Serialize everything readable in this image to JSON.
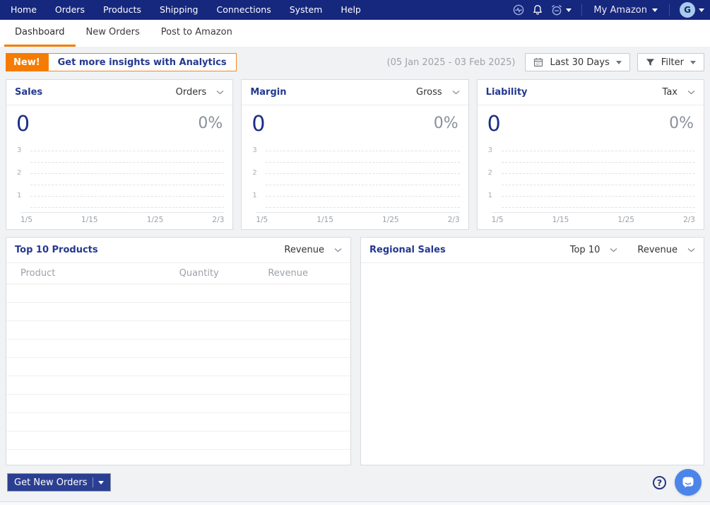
{
  "colors": {
    "navbar": "#16277E",
    "accent_orange": "#F57C00",
    "title_navy": "#24388F",
    "value_navy": "#1B2F87",
    "muted_gray": "#8A909A",
    "button_navy": "#2B3F92",
    "chat_blue": "#4C85EA",
    "avatar_blue": "#A9CBEE"
  },
  "navbar": {
    "items": [
      "Home",
      "Orders",
      "Products",
      "Shipping",
      "Connections",
      "System",
      "Help"
    ],
    "icons": [
      "activity-icon",
      "notifications-bell-icon",
      "snooze-alarm-icon"
    ],
    "account_label": "My Amazon",
    "avatar_initial": "G"
  },
  "tabs": {
    "dashboard": "Dashboard",
    "new_orders": "New Orders",
    "post_to_amazon": "Post to Amazon",
    "active": "Dashboard"
  },
  "toolbar": {
    "new_badge": "New!",
    "analytics_label": "Get more insights with Analytics",
    "date_range": "(05 Jan 2025 - 03 Feb 2025)",
    "period_label": "Last 30 Days",
    "filter_label": "Filter"
  },
  "metric_cards": [
    {
      "title": "Sales",
      "dropdown": "Orders",
      "value": "0",
      "percent": "0%"
    },
    {
      "title": "Margin",
      "dropdown": "Gross",
      "value": "0",
      "percent": "0%"
    },
    {
      "title": "Liability",
      "dropdown": "Tax",
      "value": "0",
      "percent": "0%"
    }
  ],
  "chart_data": {
    "type": "line",
    "applies_to": [
      "Sales",
      "Margin",
      "Liability"
    ],
    "title": "",
    "x_ticks": [
      "1/5",
      "1/15",
      "1/25",
      "2/3"
    ],
    "y_ticks": [
      "3",
      "2",
      "1"
    ],
    "ylim": [
      0,
      3.5
    ],
    "grid": "dashed-horizontal",
    "series": []
  },
  "top_products": {
    "title": "Top 10 Products",
    "dropdown": "Revenue",
    "columns": [
      "Product",
      "Quantity",
      "Revenue"
    ],
    "rows": []
  },
  "regional_sales": {
    "title": "Regional Sales",
    "dropdown_scope": "Top 10",
    "dropdown_metric": "Revenue"
  },
  "footer": {
    "get_new_orders_label": "Get New Orders",
    "help_glyph": "?"
  }
}
